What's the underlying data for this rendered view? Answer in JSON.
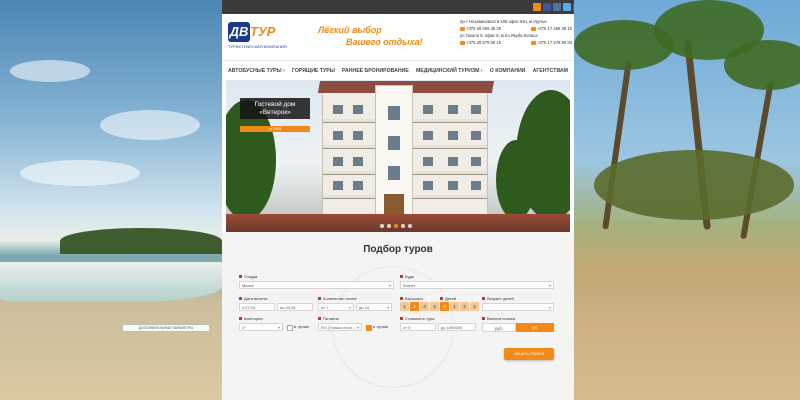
{
  "brand": {
    "logo_badge": "ДВ",
    "logo_word": "ТУР",
    "tagline": "ТУРИСТИЧЕСКАЯ КОМПАНИЯ",
    "slogan_line1": "Лёгкий выбор",
    "slogan_line2": "Вашего отдыха!"
  },
  "contacts": {
    "address1": "пр-т Независимости 185 офис 53н, м.Уручье",
    "phone1": "+375 29 356 36 36",
    "phone2": "+375 17 286 36 16",
    "address2": "ул.Гикало 6, офис 8, м.пл.Якуба Коласа",
    "phone3": "+375 29 679 00 15",
    "phone4": "+375 17 276 80 83"
  },
  "nav": {
    "items": [
      "АВТОБУСНЫЕ ТУРЫ ›",
      "ГОРЯЩИЕ ТУРЫ",
      "РАННЕЕ БРОНИРОВАНИЕ",
      "МЕДИЦИНСКИЙ ТУРИЗМ ›",
      "О КОМПАНИИ",
      "АГЕНТСТВАМ"
    ]
  },
  "hero": {
    "caption_line1": "Гостевой дом",
    "caption_line2": "«Ветерок»",
    "price_label": "от 300$"
  },
  "search": {
    "title": "Подбор туров",
    "labels": {
      "from": "Откуда",
      "to": "Куда",
      "date": "Дата вылета",
      "nights": "Количество ночей",
      "adults": "Взрослых",
      "children": "Детей",
      "child_age": "Возраст детей",
      "category": "Категория",
      "meal": "Питание",
      "price": "Стоимость тура",
      "currency": "Валюта поиска",
      "or_better": "и лучше"
    },
    "values": {
      "from": "Минск",
      "to": "Египет",
      "date_from_prefix": "с",
      "date_from": "07.04",
      "date_to_prefix": "по",
      "date_to": "04.04",
      "nights_from_prefix": "от",
      "nights_from": "7",
      "nights_to_prefix": "до",
      "nights_to": "14",
      "category": "1*",
      "meal": "RO (Только ночл...",
      "price_from_prefix": "от",
      "price_from": "0",
      "price_to_prefix": "до",
      "price_to": "1000000"
    },
    "adult_options": [
      "1",
      "2",
      "3",
      "4"
    ],
    "child_options": [
      "0",
      "1",
      "2",
      "3"
    ],
    "currency_options": [
      "руб.",
      "у.е."
    ],
    "more_filters_label": "ДОПОЛНИТЕЛЬНЫЕ ПАРАМЕТРЫ",
    "submit_label": "НАЧАТЬ ПОИСК"
  },
  "colors": {
    "accent": "#f28a1a",
    "brand_blue": "#1a3a8c",
    "dark_bar": "#3b3b3b"
  }
}
